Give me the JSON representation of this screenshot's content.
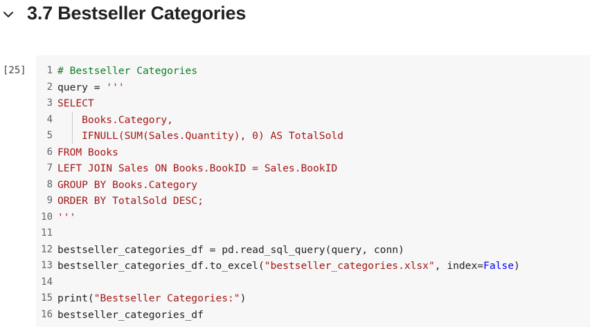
{
  "section": {
    "chevron_icon": "chevron-down-icon",
    "title": "3.7 Bestseller Categories"
  },
  "cell": {
    "execution_count": "[25]",
    "lines": [
      {
        "n": "1",
        "tokens": [
          {
            "t": "# Bestseller Categories",
            "c": "comment"
          }
        ]
      },
      {
        "n": "2",
        "tokens": [
          {
            "t": "query = ",
            "c": "default"
          },
          {
            "t": "'''",
            "c": "string"
          }
        ]
      },
      {
        "n": "3",
        "tokens": [
          {
            "t": "SELECT",
            "c": "string"
          }
        ]
      },
      {
        "n": "4",
        "guide": true,
        "tokens": [
          {
            "t": "    Books.Category,",
            "c": "string"
          }
        ]
      },
      {
        "n": "5",
        "guide": true,
        "tokens": [
          {
            "t": "    IFNULL(SUM(Sales.Quantity), 0) AS TotalSold",
            "c": "string"
          }
        ]
      },
      {
        "n": "6",
        "tokens": [
          {
            "t": "FROM Books",
            "c": "string"
          }
        ]
      },
      {
        "n": "7",
        "tokens": [
          {
            "t": "LEFT JOIN Sales ON Books.BookID = Sales.BookID",
            "c": "string"
          }
        ]
      },
      {
        "n": "8",
        "tokens": [
          {
            "t": "GROUP BY Books.Category",
            "c": "string"
          }
        ]
      },
      {
        "n": "9",
        "tokens": [
          {
            "t": "ORDER BY TotalSold DESC;",
            "c": "string"
          }
        ]
      },
      {
        "n": "10",
        "tokens": [
          {
            "t": "'''",
            "c": "string"
          }
        ]
      },
      {
        "n": "11",
        "tokens": []
      },
      {
        "n": "12",
        "tokens": [
          {
            "t": "bestseller_categories_df = pd.read_sql_query(query, conn)",
            "c": "default"
          }
        ]
      },
      {
        "n": "13",
        "tokens": [
          {
            "t": "bestseller_categories_df.to_excel(",
            "c": "default"
          },
          {
            "t": "\"bestseller_categories.xlsx\"",
            "c": "string"
          },
          {
            "t": ", index=",
            "c": "default"
          },
          {
            "t": "False",
            "c": "keyword"
          },
          {
            "t": ")",
            "c": "default"
          }
        ]
      },
      {
        "n": "14",
        "tokens": []
      },
      {
        "n": "15",
        "tokens": [
          {
            "t": "print(",
            "c": "default"
          },
          {
            "t": "\"Bestseller Categories:\"",
            "c": "string"
          },
          {
            "t": ")",
            "c": "default"
          }
        ]
      },
      {
        "n": "16",
        "tokens": [
          {
            "t": "bestseller_categories_df",
            "c": "default"
          }
        ]
      }
    ]
  },
  "colors": {
    "comment": "#0a7d25",
    "string": "#a31515",
    "keyword": "#0000ff",
    "default": "#212121",
    "editor_bg": "#f7f7f7"
  }
}
